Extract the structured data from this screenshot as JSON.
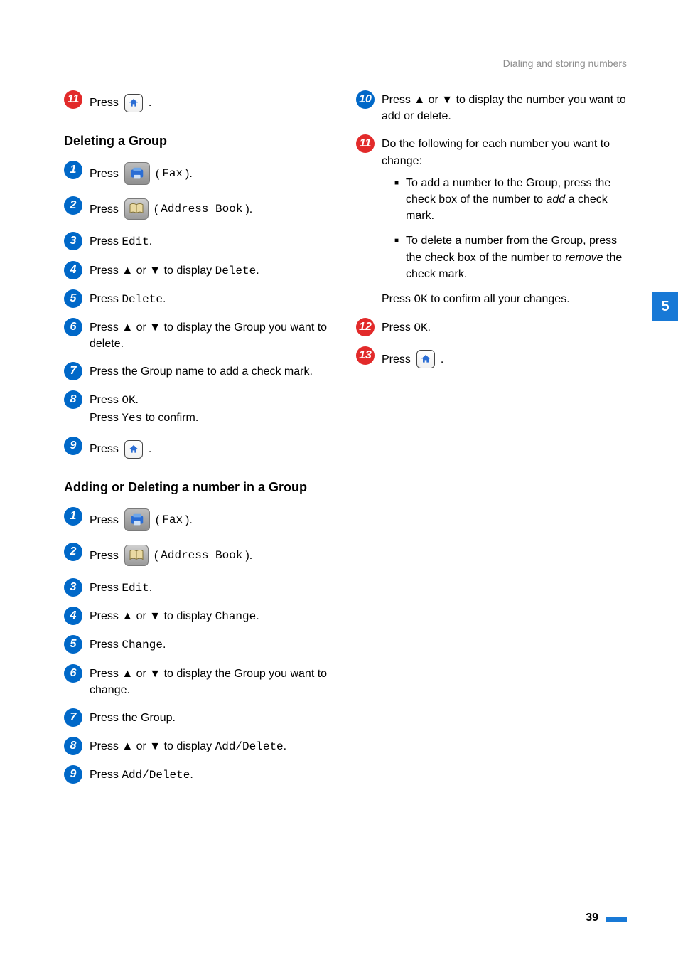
{
  "header": {
    "section_title": "Dialing and storing numbers"
  },
  "side_tab": {
    "label": "5"
  },
  "footer": {
    "page_number": "39"
  },
  "left": {
    "step11": {
      "press": "Press ",
      "period": "."
    },
    "heading_delete_group": "Deleting a Group",
    "dg": {
      "s1": {
        "press": "Press ",
        "lp": "(",
        "mono": "Fax",
        "rp": ")."
      },
      "s2": {
        "press": "Press ",
        "lp": "(",
        "mono": "Address Book",
        "rp": ")."
      },
      "s3": {
        "press": "Press ",
        "mono": "Edit",
        "period": "."
      },
      "s4": {
        "pre": "Press ▲ or ▼ to display ",
        "mono": "Delete",
        "post": "."
      },
      "s5": {
        "press": "Press ",
        "mono": "Delete",
        "period": "."
      },
      "s6": "Press ▲ or ▼ to display the Group you want to delete.",
      "s7": "Press the Group name to add a check mark.",
      "s8": {
        "l1_press": "Press ",
        "l1_mono": "OK",
        "l1_period": ".",
        "l2_press": "Press ",
        "l2_mono": "Yes",
        "l2_post": " to confirm."
      },
      "s9": {
        "press": "Press ",
        "period": "."
      }
    },
    "heading_add_delete": "Adding or Deleting a number in a Group",
    "ad": {
      "s1": {
        "press": "Press ",
        "lp": "(",
        "mono": "Fax",
        "rp": ")."
      },
      "s2": {
        "press": "Press ",
        "lp": "(",
        "mono": "Address Book",
        "rp": ")."
      },
      "s3": {
        "press": "Press ",
        "mono": "Edit",
        "period": "."
      },
      "s4": {
        "pre": "Press ▲ or ▼ to display ",
        "mono": "Change",
        "post": "."
      },
      "s5": {
        "press": "Press ",
        "mono": "Change",
        "period": "."
      },
      "s6": "Press ▲ or ▼ to display the Group you want to change.",
      "s7": "Press the Group.",
      "s8": {
        "pre": "Press ▲ or ▼ to display ",
        "mono": "Add/Delete",
        "post": "."
      },
      "s9": {
        "press": "Press ",
        "mono": "Add/Delete",
        "period": "."
      }
    }
  },
  "right": {
    "s10": "Press ▲ or ▼ to display the number you want to add or delete.",
    "s11": {
      "intro": "Do the following for each number you want to change:",
      "b1_pre": "To add a number to the Group, press the check box of the number to ",
      "b1_em": "add",
      "b1_post": " a check mark.",
      "b2_pre": "To delete a number from the Group, press the check box of the number to ",
      "b2_em": "remove",
      "b2_post": " the check mark.",
      "confirm_pre": "Press ",
      "confirm_mono": "OK",
      "confirm_post": " to confirm all your changes."
    },
    "s12": {
      "press": "Press ",
      "mono": "OK",
      "period": "."
    },
    "s13": {
      "press": "Press ",
      "period": "."
    }
  }
}
